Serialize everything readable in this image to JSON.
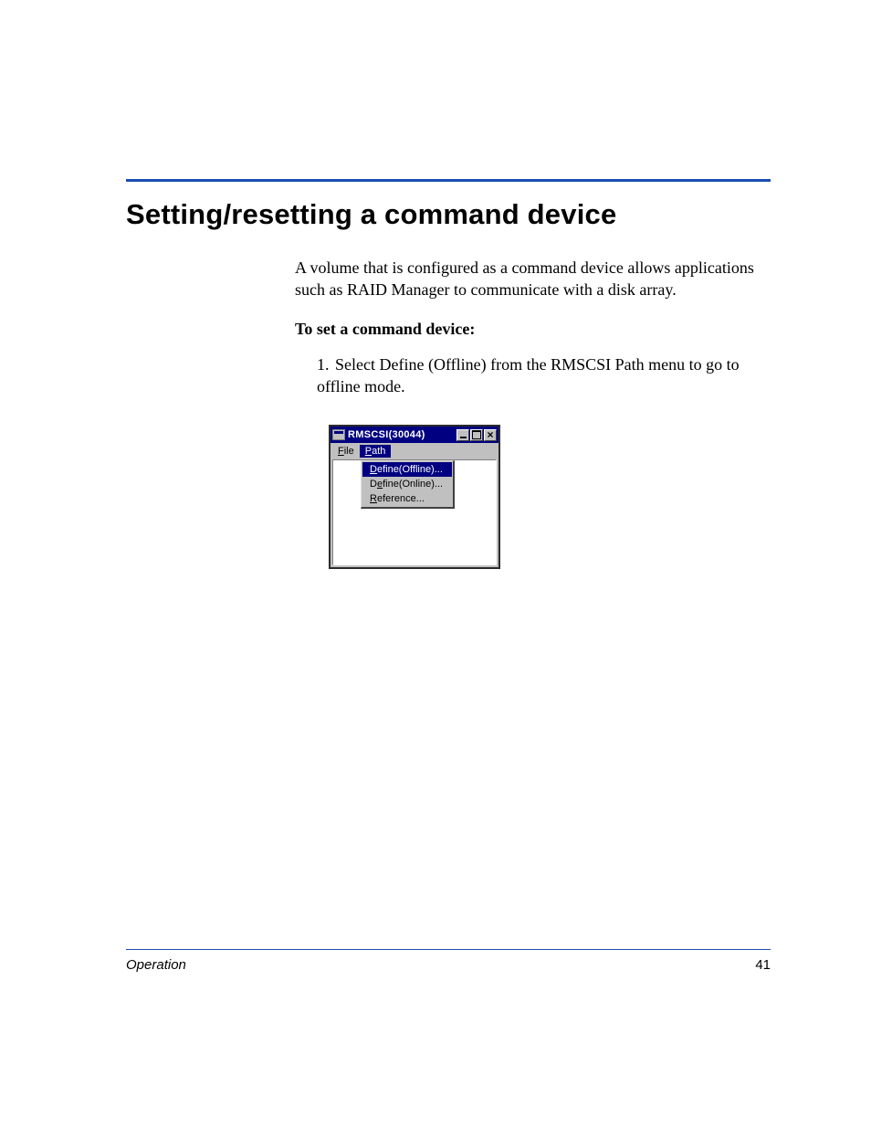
{
  "heading": "Setting/resetting a command device",
  "para1": "A volume that is configured as a command device allows applications such as RAID Manager to communicate with a disk array.",
  "subhead": "To set a command device:",
  "step1_num": "1.",
  "step1_text": "Select Define (Offline) from the RMSCSI Path menu to go to offline mode.",
  "app": {
    "title": "RMSCSI(30044)",
    "menu": {
      "file": "File",
      "path": "Path"
    },
    "dropdown": {
      "define_offline": "Define(Offline)...",
      "define_online": "Define(Online)...",
      "reference": "Reference..."
    }
  },
  "footer": {
    "section": "Operation",
    "page": "41"
  }
}
